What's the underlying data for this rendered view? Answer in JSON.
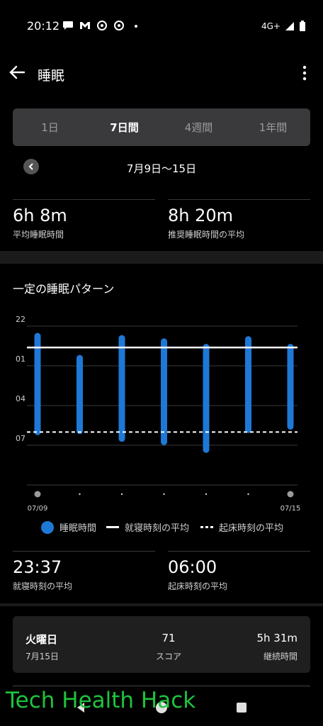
{
  "status_bar": {
    "time": "20:12",
    "network": "4G+",
    "icons_left": [
      "chat-icon",
      "gmail-icon",
      "chrome-icon",
      "chrome-icon",
      "dot-icon"
    ],
    "icons_right": [
      "signal-icon",
      "battery-icon"
    ]
  },
  "app_bar": {
    "title": "睡眠",
    "back_icon": "arrow-left-icon",
    "menu_icon": "more-vert-icon"
  },
  "tabs": [
    {
      "label": "1日",
      "active": false
    },
    {
      "label": "7日間",
      "active": true
    },
    {
      "label": "4週間",
      "active": false
    },
    {
      "label": "1年間",
      "active": false
    }
  ],
  "range": {
    "label": "7月9日～15日"
  },
  "stats_top": [
    {
      "value": "6h 8m",
      "label": "平均睡眠時間"
    },
    {
      "value": "8h 20m",
      "label": "推奨睡眠時間の平均"
    }
  ],
  "section": {
    "title": "一定の睡眠パターン"
  },
  "chart_data": {
    "type": "bar",
    "y_tick_labels": [
      "22",
      "01",
      "04",
      "07"
    ],
    "x_tick_labels": [
      "07/09",
      "07/15"
    ],
    "bedtime_average": "23:37",
    "wake_average": "06:00",
    "bars": [
      {
        "start": "22:45",
        "end": "06:00"
      },
      {
        "start": "00:25",
        "end": "05:55"
      },
      {
        "start": "22:55",
        "end": "06:30"
      },
      {
        "start": "23:10",
        "end": "06:45"
      },
      {
        "start": "23:35",
        "end": "07:20"
      },
      {
        "start": "23:00",
        "end": "05:50"
      },
      {
        "start": "23:35",
        "end": "05:35"
      }
    ],
    "colors": {
      "bar": "#1e78d6",
      "grid": "#3a3a3a"
    }
  },
  "legend": {
    "sleep": "睡眠時間",
    "bedtime": "就寝時刻の平均",
    "wake": "起床時刻の平均"
  },
  "stats_bottom": [
    {
      "value": "23:37",
      "label": "就寝時刻の平均"
    },
    {
      "value": "06:00",
      "label": "起床時刻の平均"
    }
  ],
  "day_card": {
    "day": "火曜日",
    "date": "7月15日",
    "score": "71",
    "score_label": "スコア",
    "duration": "5h 31m",
    "duration_label": "継続時間"
  },
  "watermark": "Tech Health Hack",
  "nav_icons": [
    "back-nav-icon",
    "home-nav-icon",
    "recents-nav-icon"
  ]
}
